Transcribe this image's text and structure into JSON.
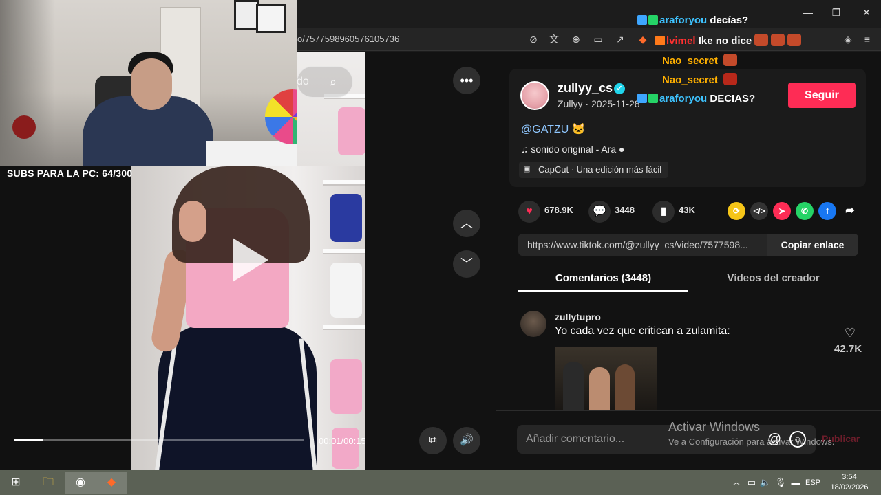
{
  "browser": {
    "url": "o/7577598960576105736"
  },
  "stream_overlay": {
    "subs_text": "SUBS PARA LA PC: 64/300"
  },
  "video": {
    "search_partial": "do",
    "time": "00:01/00:15",
    "progress_fraction": 0.1
  },
  "post": {
    "username": "zullyy_cs",
    "display_and_date": "Zullyy · 2025-11-28",
    "follow_label": "Seguir",
    "mention": "@GATZU 🐱",
    "sound": "sonido original - Ara",
    "capcut": "CapCut · Una edición más fácil",
    "likes": "678.9K",
    "comments_count": "3448",
    "saves": "43K",
    "link": "https://www.tiktok.com/@zullyy_cs/video/7577598...",
    "copy_label": "Copiar enlace"
  },
  "tabs": {
    "comments": "Comentarios (3448)",
    "creator_videos": "Vídeos del creador"
  },
  "comment": {
    "user": "zullytupro",
    "text": "Yo cada vez que critican a zulamita:",
    "likes": "42.7K"
  },
  "comment_input": {
    "placeholder": "Añadir comentario...",
    "publish": "Publicar"
  },
  "watermark": {
    "line1": "Activar Windows",
    "line2": "Ve a Configuración para activar Windows."
  },
  "chat": [
    {
      "user": "araforyou",
      "msg": "decías?",
      "color": "#3ec3ff"
    },
    {
      "user": "lvimel",
      "msg": "Ike no dice",
      "color": "#ff3030"
    },
    {
      "user": "Nao_secret",
      "msg": "",
      "color": "#ffb000"
    },
    {
      "user": "Nao_secret",
      "msg": "",
      "color": "#ffb000"
    },
    {
      "user": "araforyou",
      "msg": "DECIAS?",
      "color": "#3ec3ff"
    }
  ],
  "taskbar": {
    "lang": "ESP",
    "time": "3:54",
    "date": "18/02/2026"
  },
  "colors": {
    "accent": "#fe2c55",
    "mention": "#8fc7ff",
    "background": "#121212"
  }
}
